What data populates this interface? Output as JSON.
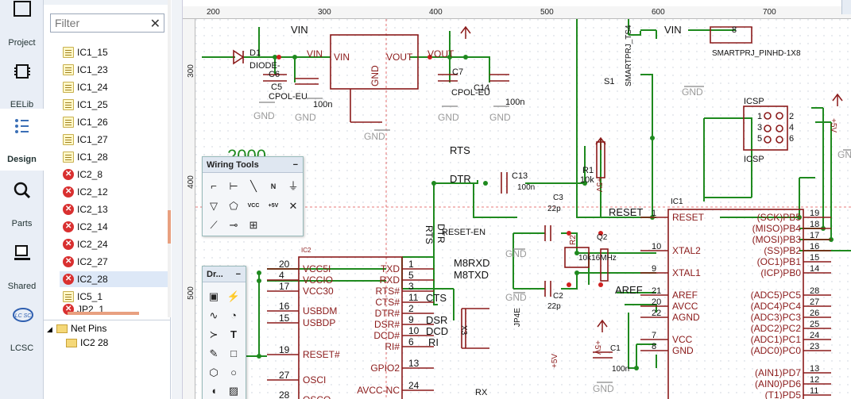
{
  "sidebar": {
    "items": [
      {
        "label": "Project",
        "icon": "project-icon"
      },
      {
        "label": "EELib",
        "icon": "chip-icon"
      },
      {
        "label": "Design",
        "icon": "design-icon"
      },
      {
        "label": "Parts",
        "icon": "search-parts-icon"
      },
      {
        "label": "Shared",
        "icon": "shared-icon"
      },
      {
        "label": "LCSC",
        "icon": "lcsc-logo-icon"
      }
    ]
  },
  "tree": {
    "filter_placeholder": "Filter",
    "rows": [
      {
        "label": "IC1_15",
        "status": "ok"
      },
      {
        "label": "IC1_23",
        "status": "ok"
      },
      {
        "label": "IC1_24",
        "status": "ok"
      },
      {
        "label": "IC1_25",
        "status": "ok"
      },
      {
        "label": "IC1_26",
        "status": "ok"
      },
      {
        "label": "IC1_27",
        "status": "ok"
      },
      {
        "label": "IC1_28",
        "status": "ok"
      },
      {
        "label": "IC2_8",
        "status": "error"
      },
      {
        "label": "IC2_12",
        "status": "error"
      },
      {
        "label": "IC2_13",
        "status": "error"
      },
      {
        "label": "IC2_14",
        "status": "error"
      },
      {
        "label": "IC2_24",
        "status": "error"
      },
      {
        "label": "IC2_27",
        "status": "error"
      },
      {
        "label": "IC2_28",
        "status": "error"
      },
      {
        "label": "IC5_1",
        "status": "ok"
      },
      {
        "label": "JP2_1",
        "status": "error"
      }
    ],
    "net_pins": {
      "label": "Net Pins",
      "child": "IC2 28"
    }
  },
  "ruler": {
    "top_ticks": [
      "200",
      "300",
      "400",
      "500",
      "600",
      "700"
    ],
    "left_ticks": [
      "300",
      "400",
      "500"
    ]
  },
  "wiring_tools": {
    "title": "Wiring Tools",
    "minimize": "−"
  },
  "drawing_tools": {
    "title": "Dr...",
    "minimize": "−"
  },
  "schematic": {
    "labels": {
      "vin_top": "VIN",
      "vin_right": "VIN",
      "d1": "D1",
      "diode": "DIODE-",
      "c6": "C6",
      "c5": "C5",
      "cpol1": "CPOL-EU",
      "reg_vin_net": "VIN",
      "reg_vin": "VIN",
      "reg_vout": "VOUT",
      "vout_net": "VOUT",
      "reg_gnd": "GND",
      "c7": "C7",
      "cpol2": "CPOL-EU",
      "c14": "C14",
      "c100n_a": "100n",
      "c100n_b": "100n",
      "gnd_a": "GND",
      "gnd_b": "GND",
      "gnd_c": "GND",
      "gnd_d": "GND",
      "gnd_e": "GND",
      "gnd_f": "GND",
      "gnd_g": "GND",
      "gnd_h": "GND",
      "gnd_i": "GND",
      "gnd_j": "GND",
      "smartprj_ts4": "SMARTPRJ_TS4",
      "smartprj_pinhd": "SMARTPRJ_PINHD-1X8",
      "s1": "S1",
      "icsp": "ICSP",
      "icsp2": "ICSP",
      "p1": "1",
      "p2": "2",
      "p3": "3",
      "p4": "4",
      "p5": "5",
      "p6": "6",
      "pin8": "8",
      "rts": "RTS",
      "dtr": "DTR",
      "c13": "C13",
      "c13v": "100n",
      "r1": "R1",
      "r1v": "10k",
      "c3": "C3",
      "c3v": "22p",
      "reset": "RESET",
      "reset_en": "RESET-EN",
      "rts_v": "RTS",
      "dtr_v": "DTR",
      "r2": "R2",
      "q2": "Q2",
      "q2v": "10k16MHz",
      "c2": "C2",
      "c2v": "22p",
      "aref": "AREF",
      "jp4e": "JP4E",
      "c1": "C1",
      "c1v": "100n",
      "plus5v_a": "+5V",
      "plus5v_b": "+5V",
      "plus5v_c": "+5V",
      "plus5v_d": "+5V",
      "ic1": "IC1",
      "ic2": "IC2",
      "cts": "CTS",
      "dsr": "DSR",
      "dcd": "DCD",
      "ri": "RI",
      "m8rxd": "M8RXD",
      "m8txd": "M8TXD",
      "rx": "RX",
      "x3": "X3",
      "twok": "2000"
    },
    "ic1_left": [
      {
        "pin": "1",
        "name": "RESET"
      },
      {
        "pin": "10",
        "name": "XTAL2"
      },
      {
        "pin": "9",
        "name": "XTAL1"
      },
      {
        "pin": "21",
        "name": "AREF"
      },
      {
        "pin": "20",
        "name": "AVCC"
      },
      {
        "pin": "22",
        "name": "AGND"
      },
      {
        "pin": "7",
        "name": "VCC"
      },
      {
        "pin": "8",
        "name": "GND"
      }
    ],
    "ic1_right": [
      {
        "pin": "19",
        "name": "(SCK)PB5"
      },
      {
        "pin": "18",
        "name": "(MISO)PB4"
      },
      {
        "pin": "17",
        "name": "(MOSI)PB3"
      },
      {
        "pin": "16",
        "name": "(SS)PB2"
      },
      {
        "pin": "15",
        "name": "(OC1)PB1"
      },
      {
        "pin": "14",
        "name": "(ICP)PB0"
      },
      {
        "pin": "28",
        "name": "(ADC5)PC5"
      },
      {
        "pin": "27",
        "name": "(ADC4)PC4"
      },
      {
        "pin": "26",
        "name": "(ADC3)PC3"
      },
      {
        "pin": "25",
        "name": "(ADC2)PC2"
      },
      {
        "pin": "24",
        "name": "(ADC1)PC1"
      },
      {
        "pin": "23",
        "name": "(ADC0)PC0"
      },
      {
        "pin": "13",
        "name": "(AIN1)PD7"
      },
      {
        "pin": "12",
        "name": "(AIN0)PD6"
      },
      {
        "pin": "11",
        "name": "(T1)PD5"
      }
    ],
    "ic2_left": [
      {
        "pin": "20",
        "name": "VCC5I"
      },
      {
        "pin": "4",
        "name": "VCCIO"
      },
      {
        "pin": "17",
        "name": "VCC30"
      },
      {
        "pin": "16",
        "name": "USBDM"
      },
      {
        "pin": "15",
        "name": "USBDP"
      },
      {
        "pin": "19",
        "name": "RESET#"
      },
      {
        "pin": "27",
        "name": "OSCI"
      },
      {
        "pin": "28",
        "name": "OSCO"
      }
    ],
    "ic2_right": [
      {
        "pin": "1",
        "name": "TXD"
      },
      {
        "pin": "5",
        "name": "RXD"
      },
      {
        "pin": "3",
        "name": "RTS#"
      },
      {
        "pin": "11",
        "name": "CTS#"
      },
      {
        "pin": "2",
        "name": "DTR#"
      },
      {
        "pin": "9",
        "name": "DSR#"
      },
      {
        "pin": "10",
        "name": "DCD#"
      },
      {
        "pin": "6",
        "name": "RI#"
      },
      {
        "pin": "13",
        "name": "GPIO2"
      },
      {
        "pin": "24",
        "name": "AVCC-NC"
      }
    ]
  },
  "colors": {
    "wire": "#1f8a1f",
    "part": "#8b1a1a",
    "gnd": "#9a9a9a",
    "grid": "#cfd6df",
    "accent": "#3b6fb6"
  }
}
